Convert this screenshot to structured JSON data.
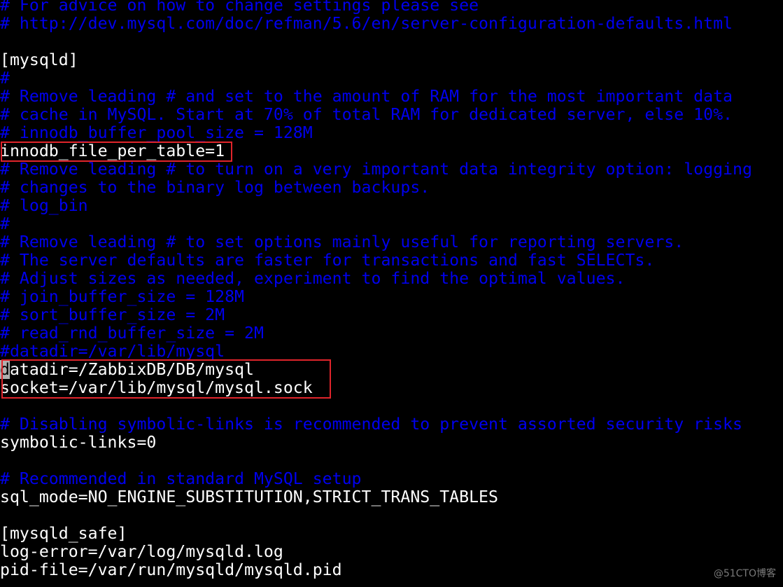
{
  "app": "terminal text editor (my.cnf)",
  "colors": {
    "comment": "#0000ee",
    "text": "#ffffff",
    "highlight_box": "#e0242b",
    "background": "#000000"
  },
  "lines": [
    {
      "text": "# For advice on how to change settings please see",
      "type": "comment"
    },
    {
      "text": "# http://dev.mysql.com/doc/refman/5.6/en/server-configuration-defaults.html",
      "type": "comment"
    },
    {
      "text": "",
      "type": "plain"
    },
    {
      "text": "[mysqld]",
      "type": "plain"
    },
    {
      "text": "#",
      "type": "comment"
    },
    {
      "text": "# Remove leading # and set to the amount of RAM for the most important data",
      "type": "comment"
    },
    {
      "text": "# cache in MySQL. Start at 70% of total RAM for dedicated server, else 10%.",
      "type": "comment"
    },
    {
      "text": "# innodb_buffer_pool_size = 128M",
      "type": "comment"
    },
    {
      "text": "innodb_file_per_table=1",
      "type": "plain"
    },
    {
      "text": "# Remove leading # to turn on a very important data integrity option: logging",
      "type": "comment"
    },
    {
      "text": "# changes to the binary log between backups.",
      "type": "comment"
    },
    {
      "text": "# log_bin",
      "type": "comment"
    },
    {
      "text": "#",
      "type": "comment"
    },
    {
      "text": "# Remove leading # to set options mainly useful for reporting servers.",
      "type": "comment"
    },
    {
      "text": "# The server defaults are faster for transactions and fast SELECTs.",
      "type": "comment"
    },
    {
      "text": "# Adjust sizes as needed, experiment to find the optimal values.",
      "type": "comment"
    },
    {
      "text": "# join_buffer_size = 128M",
      "type": "comment"
    },
    {
      "text": "# sort_buffer_size = 2M",
      "type": "comment"
    },
    {
      "text": "# read_rnd_buffer_size = 2M",
      "type": "comment"
    },
    {
      "text": "#datadir=/var/lib/mysql",
      "type": "comment"
    },
    {
      "text": "datadir=/ZabbixDB/DB/mysql",
      "type": "plain",
      "cursor_col": 0
    },
    {
      "text": "socket=/var/lib/mysql/mysql.sock",
      "type": "plain"
    },
    {
      "text": "",
      "type": "plain"
    },
    {
      "text": "# Disabling symbolic-links is recommended to prevent assorted security risks",
      "type": "comment"
    },
    {
      "text": "symbolic-links=0",
      "type": "plain"
    },
    {
      "text": "",
      "type": "plain"
    },
    {
      "text": "# Recommended in standard MySQL setup",
      "type": "comment"
    },
    {
      "text": "sql_mode=NO_ENGINE_SUBSTITUTION,STRICT_TRANS_TABLES",
      "type": "plain"
    },
    {
      "text": "",
      "type": "plain"
    },
    {
      "text": "[mysqld_safe]",
      "type": "plain"
    },
    {
      "text": "log-error=/var/log/mysqld.log",
      "type": "plain"
    },
    {
      "text": "pid-file=/var/run/mysqld/mysqld.pid",
      "type": "plain"
    }
  ],
  "highlights": [
    {
      "label": "innodb-file-per-table-highlight",
      "lines": [
        8,
        8
      ]
    },
    {
      "label": "datadir-socket-highlight",
      "lines": [
        20,
        21
      ]
    }
  ],
  "watermark": "@51CTO博客"
}
